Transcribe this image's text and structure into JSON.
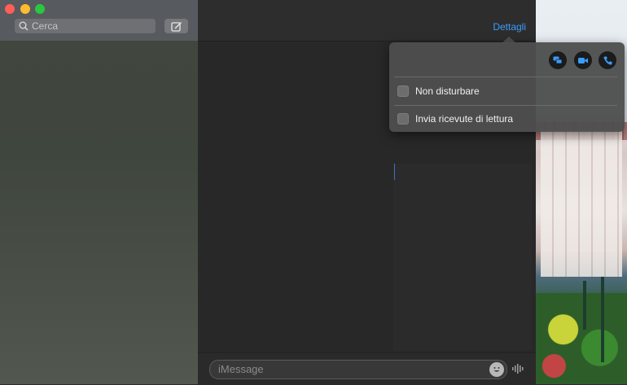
{
  "window": {
    "sidebar": {
      "search_placeholder": "Cerca"
    },
    "header": {
      "details_label": "Dettagli"
    },
    "composer": {
      "message_placeholder": "iMessage"
    }
  },
  "details_popover": {
    "options": [
      {
        "label": "Non disturbare",
        "checked": false
      },
      {
        "label": "Invia ricevute di lettura",
        "checked": false
      }
    ]
  },
  "colors": {
    "accent": "#3b9cff",
    "close": "#ff5f57",
    "minimize": "#febc2e",
    "maximize": "#28c840"
  }
}
